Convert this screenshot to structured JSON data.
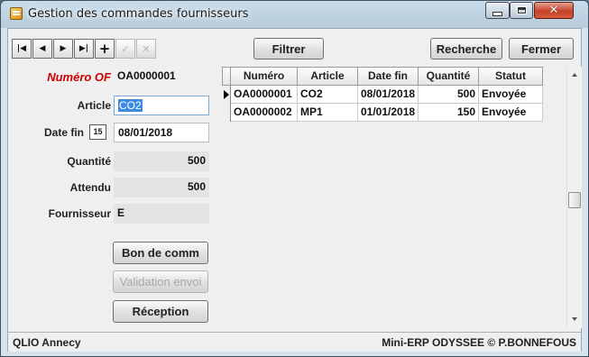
{
  "window": {
    "title": "Gestion des commandes fournisseurs",
    "minimize_icon": "minimize-icon",
    "maximize_icon": "maximize-icon",
    "close_icon": "close-icon",
    "close_glyph": "✕",
    "accent_close": "#c6412a"
  },
  "toolbar": {
    "nav_buttons": [
      {
        "icon": "first-record-icon",
        "glyph": "|◀"
      },
      {
        "icon": "previous-record-icon",
        "glyph": "◀"
      },
      {
        "icon": "next-record-icon",
        "glyph": "▶"
      },
      {
        "icon": "last-record-icon",
        "glyph": "▶|"
      },
      {
        "icon": "add-record-icon",
        "glyph": "+"
      },
      {
        "icon": "validate-record-icon",
        "glyph": "✓"
      },
      {
        "icon": "cancel-record-icon",
        "glyph": "✕"
      }
    ],
    "filter_label": "Filtrer",
    "search_label": "Recherche",
    "close_label": "Fermer"
  },
  "form": {
    "numero_of_label": "Numéro OF",
    "numero_of_value": "OA0000001",
    "numero_of_color": "#cc0000",
    "article_label": "Article",
    "article_value": "CO2",
    "date_fin_label": "Date fin",
    "calendar_icon": "calendar-icon",
    "calendar_glyph": "15",
    "date_fin_value": "08/01/2018",
    "quantite_label": "Quantité",
    "quantite_value": "500",
    "attendu_label": "Attendu",
    "attendu_value": "500",
    "fournisseur_label": "Fournisseur",
    "fournisseur_value": "E",
    "bon_de_commande_label": "Bon de comm",
    "validation_envoi_label": "Validation envoi",
    "reception_label": "Réception"
  },
  "grid": {
    "columns": [
      "Numéro",
      "Article",
      "Date fin",
      "Quantité",
      "Statut"
    ],
    "rows": [
      {
        "numero": "OA0000001",
        "article": "CO2",
        "date_fin": "08/01/2018",
        "quantite": "500",
        "statut": "Envoyée",
        "current": true
      },
      {
        "numero": "OA0000002",
        "article": "MP1",
        "date_fin": "01/01/2018",
        "quantite": "150",
        "statut": "Envoyée",
        "current": false
      }
    ]
  },
  "status": {
    "left": "QLIO Annecy",
    "right": "Mini-ERP ODYSSEE © P.BONNEFOUS"
  }
}
